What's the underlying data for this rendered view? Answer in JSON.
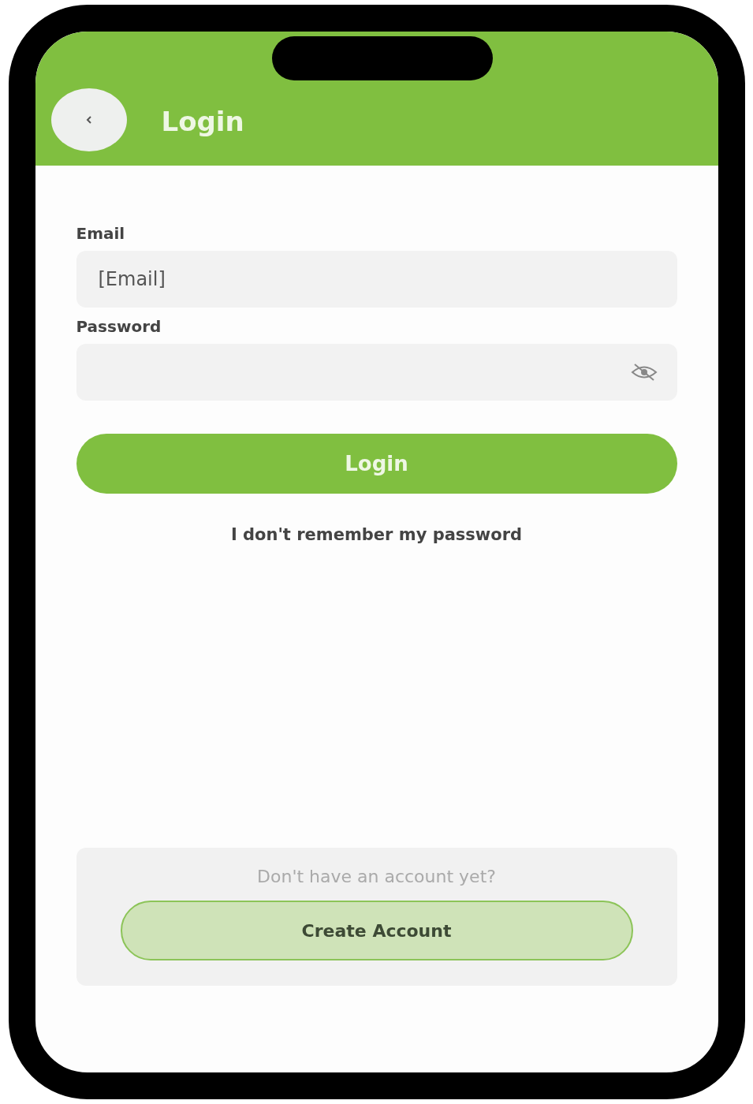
{
  "header": {
    "title": "Login"
  },
  "fields": [
    {
      "kind": "text",
      "label": "Email",
      "value": "[Email]"
    },
    {
      "kind": "password",
      "label": "Password"
    }
  ],
  "login_button": "Login",
  "forgot_link": "I don't remember my password",
  "signup": {
    "prompt": "Don't have an account yet?",
    "button": "Create Account"
  }
}
